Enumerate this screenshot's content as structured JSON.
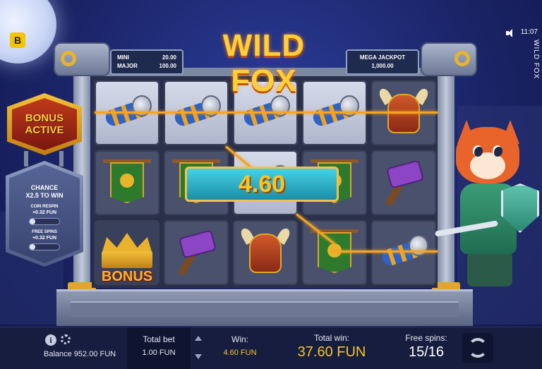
{
  "game": {
    "title": "WILD FOX",
    "logo_letter": "B",
    "clock": "11:07",
    "vertical_title": "WILD FOX"
  },
  "jackpots": {
    "mini_label": "MINI",
    "mini_value": "20.00",
    "major_label": "MAJOR",
    "major_value": "100.00",
    "mega_label": "MEGA JACKPOT",
    "mega_value": "1,000.00"
  },
  "bonus_panel": {
    "active_line1": "BONUS",
    "active_line2": "ACTIVE",
    "chance_line1": "CHANCE",
    "chance_line2": "X2.5 TO WIN",
    "coin_respin_label": "COIN RESPIN",
    "coin_respin_amount": "+0.32 FUN",
    "free_spins_label": "FREE SPINS",
    "free_spins_amount": "+0.32 FUN"
  },
  "reels": [
    [
      "horn",
      "banner",
      "crown-bonus"
    ],
    [
      "horn",
      "banner",
      "hammer"
    ],
    [
      "horn",
      "horn",
      "helmet"
    ],
    [
      "horn",
      "banner",
      "banner"
    ],
    [
      "helmet",
      "hammer",
      "horn"
    ]
  ],
  "bonus_symbol_text": "BONUS",
  "win_amount": "4.60",
  "bottom_bar": {
    "balance": "Balance 952.00 FUN",
    "total_bet_label": "Total bet",
    "total_bet_value": "1.00 FUN",
    "win_label": "Win:",
    "win_value": "4.60 FUN",
    "total_win_label": "Total win:",
    "total_win_value": "37.60 FUN",
    "free_spins_label": "Free spins:",
    "free_spins_value": "15/16"
  },
  "colors": {
    "accent_gold": "#f7c42c",
    "win_line": "#f6a421",
    "background": "#1b2467"
  },
  "icons": [
    "info-icon",
    "gear-icon",
    "speaker-icon",
    "spin-icon",
    "arrow-up-icon",
    "arrow-down-icon"
  ]
}
